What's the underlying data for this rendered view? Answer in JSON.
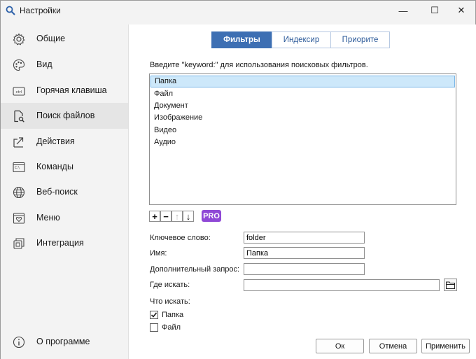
{
  "window": {
    "title": "Настройки",
    "minimize_glyph": "—",
    "maximize_glyph": "☐",
    "close_glyph": "✕"
  },
  "sidebar": {
    "items": [
      {
        "label": "Общие",
        "icon": "gear-icon"
      },
      {
        "label": "Вид",
        "icon": "palette-icon"
      },
      {
        "label": "Горячая клавиша",
        "icon": "keyboard-icon"
      },
      {
        "label": "Поиск файлов",
        "icon": "file-search-icon",
        "active": true
      },
      {
        "label": "Действия",
        "icon": "share-arrow-icon"
      },
      {
        "label": "Команды",
        "icon": "terminal-icon"
      },
      {
        "label": "Веб-поиск",
        "icon": "globe-icon"
      },
      {
        "label": "Меню",
        "icon": "menu-heart-icon"
      },
      {
        "label": "Интеграция",
        "icon": "integration-icon"
      }
    ],
    "about": {
      "label": "О программе",
      "icon": "info-icon"
    }
  },
  "tabs": [
    {
      "label": "Фильтры",
      "active": true
    },
    {
      "label": "Индексир",
      "active": false
    },
    {
      "label": "Приорите",
      "active": false
    }
  ],
  "filters": {
    "hint": "Введите \"keyword:\" для использования поисковых фильтров.",
    "items": [
      "Папка",
      "Файл",
      "Документ",
      "Изображение",
      "Видео",
      "Аудио"
    ],
    "selected_index": 0
  },
  "toolbar": {
    "add": "+",
    "remove": "−",
    "move_up": "↑",
    "move_down": "↓",
    "pro_badge": "PRO"
  },
  "form": {
    "keyword_label": "Ключевое слово:",
    "keyword_value": "folder",
    "name_label": "Имя:",
    "name_value": "Папка",
    "extra_query_label": "Дополнительный запрос:",
    "extra_query_value": "",
    "where_label": "Где искать:",
    "where_value": "",
    "what_label": "Что искать:",
    "checkboxes": [
      {
        "label": "Папка",
        "checked": true
      },
      {
        "label": "Файл",
        "checked": false
      }
    ]
  },
  "buttons": {
    "ok": "Ок",
    "cancel": "Отмена",
    "apply": "Применить"
  },
  "colors": {
    "accent": "#3d6fb3",
    "pro": "#8f48d6",
    "selection": "#cde8fa"
  }
}
